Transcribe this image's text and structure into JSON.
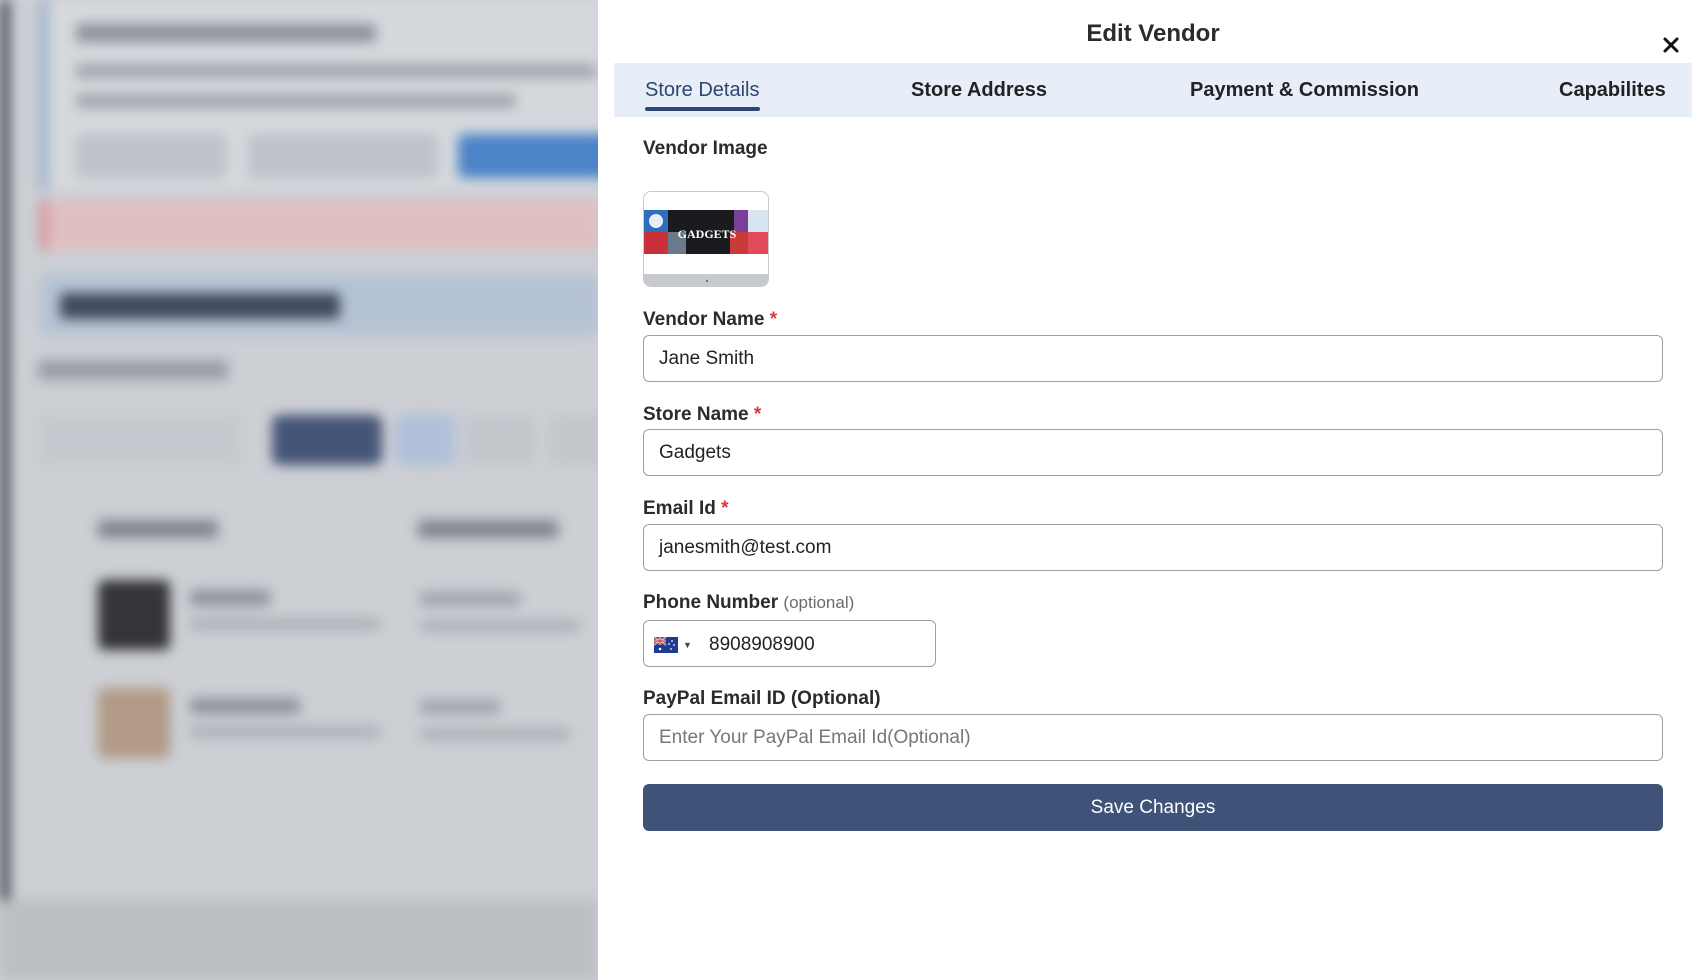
{
  "modal": {
    "title": "Edit Vendor",
    "close_icon": "close-icon"
  },
  "tabs": [
    {
      "label": "Store Details",
      "active": true
    },
    {
      "label": "Store Address",
      "active": false
    },
    {
      "label": "Payment & Commission",
      "active": false
    },
    {
      "label": "Capabilites",
      "active": false
    }
  ],
  "form": {
    "vendor_image_label": "Vendor Image",
    "vendor_image_text": "GADGETS",
    "vendor_name": {
      "label": "Vendor Name",
      "required_mark": "*",
      "value": "Jane Smith"
    },
    "store_name": {
      "label": "Store Name",
      "required_mark": "*",
      "value": "Gadgets"
    },
    "email": {
      "label": "Email Id",
      "required_mark": "*",
      "value": "janesmith@test.com"
    },
    "phone": {
      "label": "Phone Number",
      "optional_note": "(optional)",
      "country_flag": "australia-flag-icon",
      "value": "8908908900"
    },
    "paypal": {
      "label": "PayPal Email ID (Optional)",
      "placeholder": "Enter Your PayPal Email Id(Optional)",
      "value": ""
    },
    "save_label": "Save Changes"
  },
  "colors": {
    "accent": "#3f5378",
    "tab_bar_bg": "#e8eef8",
    "active_tab": "#2e4670",
    "required": "#d9383a"
  }
}
